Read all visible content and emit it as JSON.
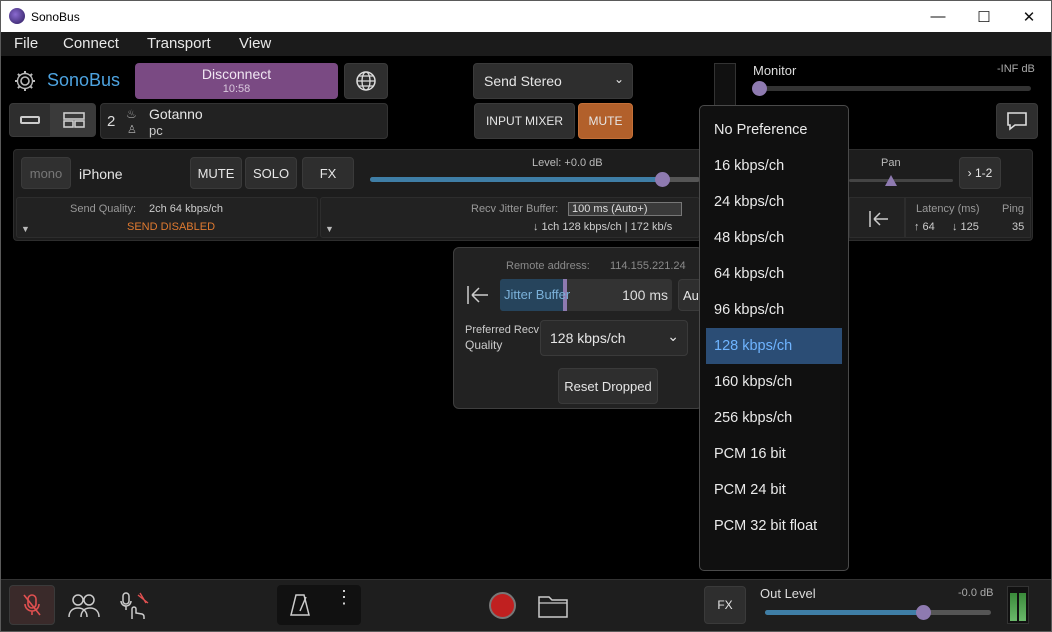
{
  "window": {
    "title": "SonoBus",
    "minimize": "—",
    "maximize": "☐",
    "close": "✕"
  },
  "menu": [
    "File",
    "Connect",
    "Transport",
    "View"
  ],
  "header": {
    "app_name": "SonoBus",
    "disconnect_label": "Disconnect",
    "session_time": "10:58",
    "send_mode": "Send Stereo",
    "input_mixer_label": "INPUT MIXER",
    "mute_label": "MUTE",
    "monitor_label": "Monitor",
    "monitor_db": "-INF dB",
    "group_count": "2",
    "group_name": "Gotanno",
    "user_name": "pc"
  },
  "peer": {
    "mono_label": "mono",
    "name": "iPhone",
    "mute_label": "MUTE",
    "solo_label": "SOLO",
    "fx_label": "FX",
    "level_label": "Level: +0.0 dB",
    "pan_label": "Pan",
    "channels_label": "1-2",
    "send_quality_label": "Send Quality:",
    "send_quality_value": "2ch 64 kbps/ch",
    "send_disabled": "SEND DISABLED",
    "recv_jitter_label": "Recv Jitter Buffer:",
    "recv_jitter_value": "100 ms (Auto+)",
    "recv_stats": "↓ 1ch 128 kbps/ch | 172 kb/s",
    "latency_label": "Latency (ms)",
    "ping_label": "Ping",
    "latency_up": "↑ 64",
    "latency_down": "↓ 125",
    "ping_value": "35",
    "level_fraction": 0.88
  },
  "popup": {
    "remote_address_label": "Remote address:",
    "remote_address_value": "114.155.221.24",
    "jitter_label": "Jitter Buffer",
    "jitter_value": "100 ms",
    "auto_label": "Au",
    "pref_recv_line1": "Preferred Recv",
    "pref_recv_line2": "Quality",
    "pref_recv_value": "128 kbps/ch",
    "reset_dropped_label": "Reset Dropped"
  },
  "quality_options": [
    {
      "label": "No Preference",
      "selected": false
    },
    {
      "label": "16 kbps/ch",
      "selected": false
    },
    {
      "label": "24 kbps/ch",
      "selected": false
    },
    {
      "label": "48 kbps/ch",
      "selected": false
    },
    {
      "label": "64 kbps/ch",
      "selected": false
    },
    {
      "label": "96 kbps/ch",
      "selected": false
    },
    {
      "label": "128 kbps/ch",
      "selected": true
    },
    {
      "label": "160 kbps/ch",
      "selected": false
    },
    {
      "label": "256 kbps/ch",
      "selected": false
    },
    {
      "label": "PCM 16 bit",
      "selected": false
    },
    {
      "label": "PCM 24 bit",
      "selected": false
    },
    {
      "label": "PCM 32 bit float",
      "selected": false
    }
  ],
  "footer": {
    "fx_label": "FX",
    "out_level_label": "Out Level",
    "out_level_db": "-0.0 dB",
    "out_level_fraction": 0.7
  },
  "colors": {
    "accent": "#3f7ea6",
    "disconnect_bg": "#7a4a83",
    "mute_bg": "#b2602b",
    "selected_bg": "#2b4d75",
    "selected_text": "#6fb4ff",
    "record": "#c02020"
  }
}
